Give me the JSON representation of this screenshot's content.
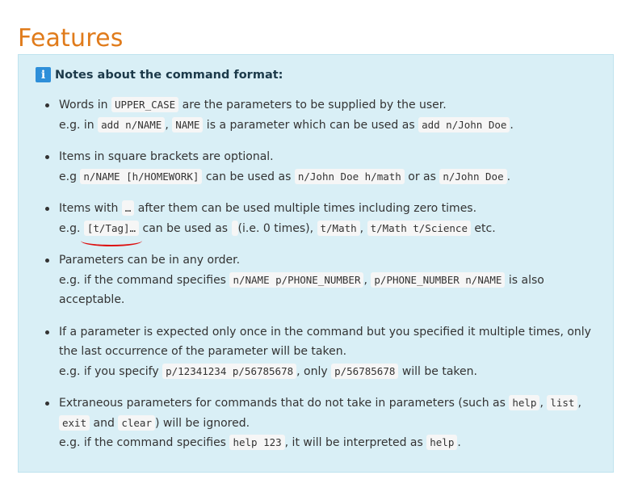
{
  "page_title": "Features",
  "notes": {
    "icon": "info-icon",
    "icon_glyph": "i",
    "title": "Notes about the command format:",
    "items": [
      {
        "l1_t1": "Words in ",
        "l1_c1": "UPPER_CASE",
        "l1_t2": " are the parameters to be supplied by the user.",
        "l2_t1": "e.g. in ",
        "l2_c1": "add n/NAME",
        "l2_t2": ", ",
        "l2_c2": "NAME",
        "l2_t3": " is a parameter which can be used as ",
        "l2_c3": "add n/John Doe",
        "l2_t4": "."
      },
      {
        "l1_t1": "Items in square brackets are optional.",
        "l2_t1": "e.g ",
        "l2_c1": "n/NAME [h/HOMEWORK]",
        "l2_t2": " can be used as ",
        "l2_c2": "n/John Doe h/math",
        "l2_t3": " or as ",
        "l2_c3": "n/John Doe",
        "l2_t4": "."
      },
      {
        "l1_t1": "Items with ",
        "l1_c1": "…",
        "l1_t2": " after them can be used multiple times including zero times.",
        "l2_t1": "e.g. ",
        "l2_c1": "[t/Tag]…",
        "l2_t2": " can be used as ",
        "l2_c2": " ",
        "l2_t3": " (i.e. 0 times), ",
        "l2_c3": "t/Math",
        "l2_t4": ", ",
        "l2_c4": "t/Math t/Science",
        "l2_t5": " etc."
      },
      {
        "l1_t1": "Parameters can be in any order.",
        "l2_t1": "e.g. if the command specifies ",
        "l2_c1": "n/NAME p/PHONE_NUMBER",
        "l2_t2": ", ",
        "l2_c2": "p/PHONE_NUMBER n/NAME",
        "l2_t3": " is also acceptable."
      },
      {
        "l1_t1": "If a parameter is expected only once in the command but you specified it multiple times, only the last occurrence of the parameter will be taken.",
        "l2_t1": "e.g. if you specify ",
        "l2_c1": "p/12341234 p/56785678",
        "l2_t2": ", only ",
        "l2_c2": "p/56785678",
        "l2_t3": " will be taken."
      },
      {
        "l1_t1": "Extraneous parameters for commands that do not take in parameters (such as ",
        "l1_c1": "help",
        "l1_t2": ", ",
        "l1_c2": "list",
        "l1_t3": ", ",
        "l1_c3": "exit",
        "l1_t4": " and ",
        "l1_c4": "clear",
        "l1_t5": ") will be ignored.",
        "l2_t1": "e.g. if the command specifies ",
        "l2_c1": "help 123",
        "l2_t2": ", it will be interpreted as ",
        "l2_c2": "help",
        "l2_t3": "."
      }
    ]
  },
  "colors": {
    "title": "#e07b1b",
    "box_background": "#d9eff6",
    "icon_background": "#2e8fd9",
    "annotation_underline": "#dd1111"
  }
}
